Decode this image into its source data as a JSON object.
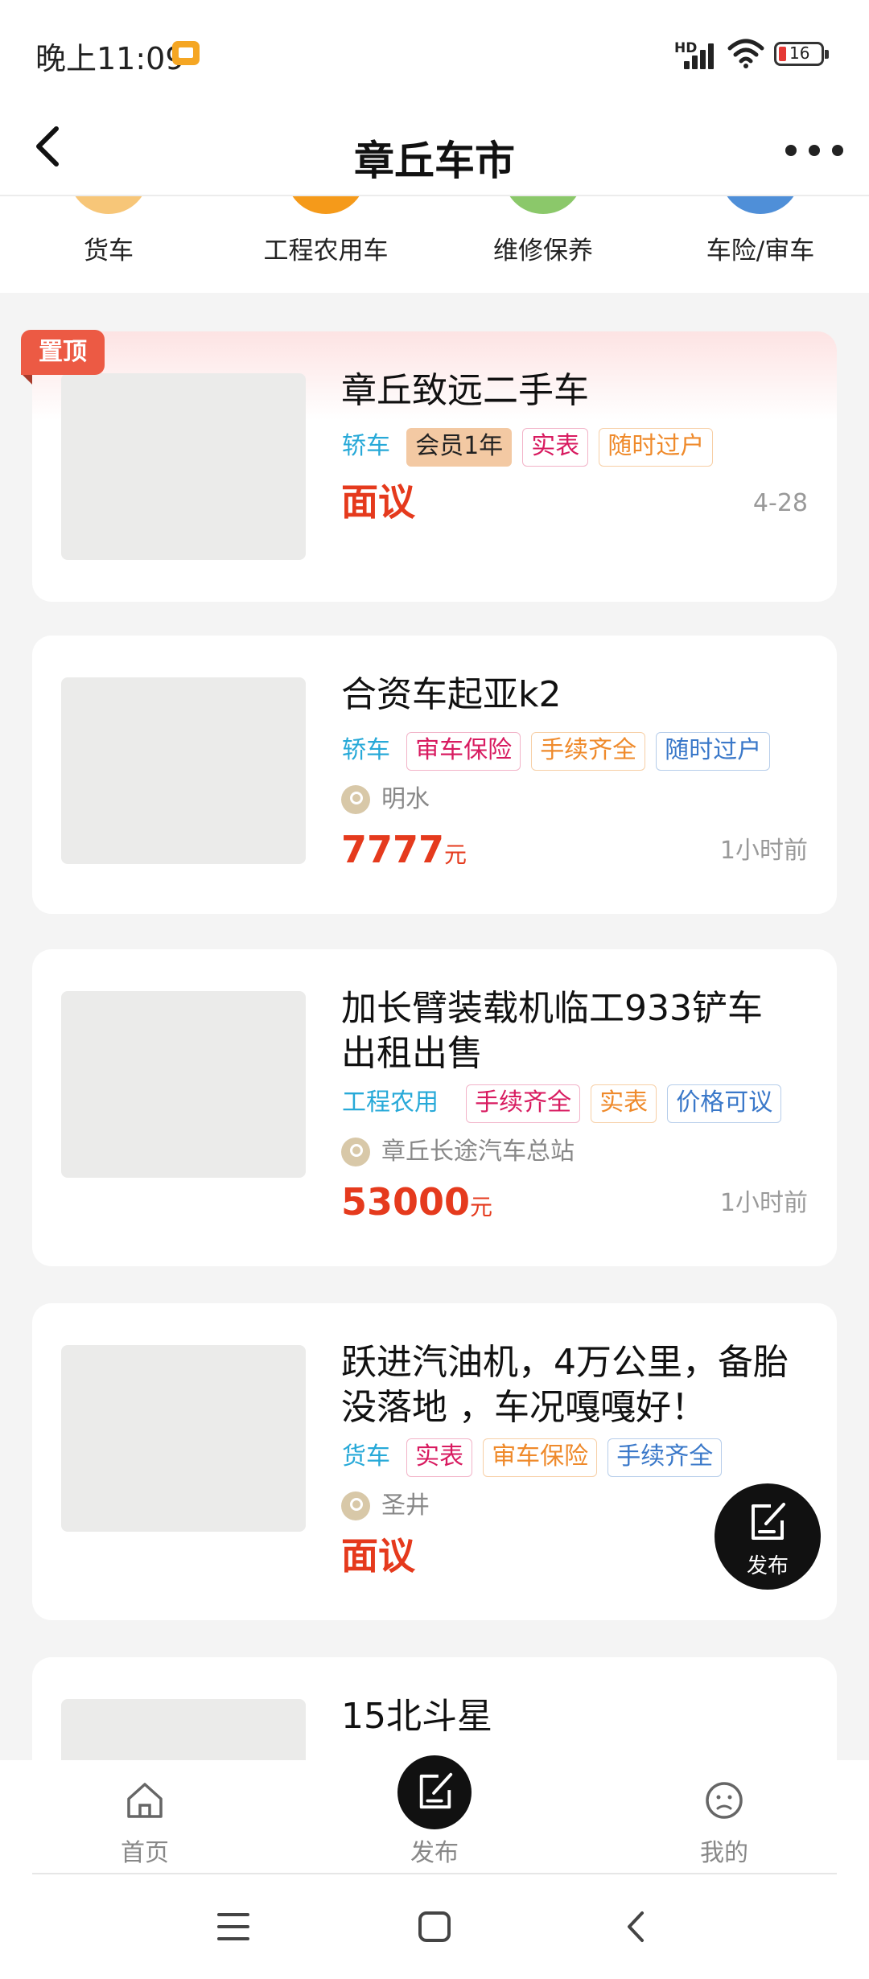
{
  "status_bar": {
    "time": "晚上11:09",
    "hd_label": "HD",
    "battery": "16"
  },
  "header": {
    "title": "章丘车市"
  },
  "categories": [
    {
      "label": "货车",
      "color": "#f7c678"
    },
    {
      "label": "工程农用车",
      "color": "#f59a1a"
    },
    {
      "label": "维修保养",
      "color": "#8bc86a"
    },
    {
      "label": "车险/审车",
      "color": "#4f8fd8"
    }
  ],
  "listings": [
    {
      "pinned": true,
      "pin_label": "置顶",
      "title": "章丘致远二手车",
      "category": "轿车",
      "tags": [
        "会员1年",
        "实表",
        "随时过户"
      ],
      "price": "面议",
      "time": "4-28"
    },
    {
      "title": "合资车起亚k2",
      "category": "轿车",
      "tags": [
        "审车保险",
        "手续齐全",
        "随时过户"
      ],
      "location": "明水",
      "price": "7777",
      "price_unit": "元",
      "time": "1小时前"
    },
    {
      "title_line1": "加长臂装载机临工933铲车",
      "title_line2": "出租出售",
      "category": "工程农用",
      "tags": [
        "手续齐全",
        "实表",
        "价格可议"
      ],
      "location": "章丘长途汽车总站",
      "price": "53000",
      "price_unit": "元",
      "time": "1小时前"
    },
    {
      "title_line1": "跃进汽油机，4万公里，备胎",
      "title_line2": "没落地 ，车况嘎嘎好！",
      "category": "货车",
      "tags": [
        "实表",
        "审车保险",
        "手续齐全"
      ],
      "location": "圣井",
      "price": "面议"
    },
    {
      "title": "15北斗星"
    }
  ],
  "fab": {
    "label": "发布"
  },
  "tabbar": {
    "home": "首页",
    "publish": "发布",
    "mine": "我的"
  },
  "colors": {
    "price": "#e53a1d",
    "category": "#27a9d8",
    "tag_pink": "#d81b60",
    "tag_orange": "#ef8a2b",
    "tag_blue": "#3a78c9",
    "tag_member_bg": "#f3c9a3",
    "pin": "#ec5a44"
  }
}
